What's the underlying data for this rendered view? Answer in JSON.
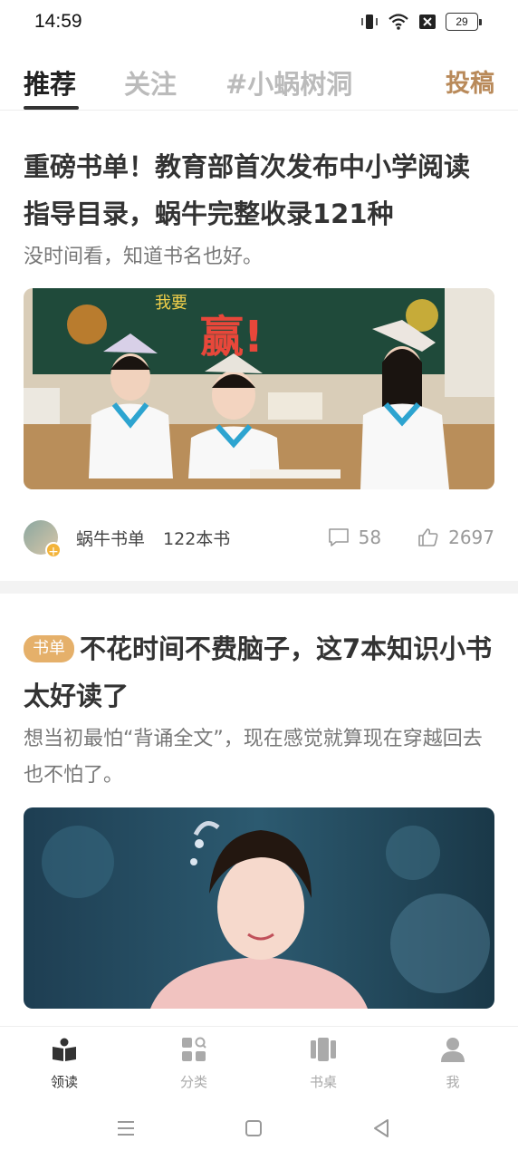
{
  "status_bar": {
    "time": "14:59",
    "battery": "29"
  },
  "tabs": [
    {
      "label": "推荐",
      "active": true
    },
    {
      "label": "关注",
      "active": false
    },
    {
      "label": "#小蜗树洞",
      "active": false
    }
  ],
  "contribute_label": "投稿",
  "articles": [
    {
      "title": "重磅书单！教育部首次发布中小学阅读指导目录，蜗牛完整收录121种",
      "description": "没时间看，知道书名也好。",
      "author": "蜗牛书单",
      "book_count": "122本书",
      "comments": "58",
      "likes": "2697"
    },
    {
      "tag": "书单",
      "title": "不花时间不费脑子，这7本知识小书太好读了",
      "description": "想当初最怕“背诵全文”，现在感觉就算现在穿越回去也不怕了。"
    }
  ],
  "bottom_nav": [
    {
      "label": "领读",
      "icon": "book-open-icon",
      "active": true
    },
    {
      "label": "分类",
      "icon": "category-search-icon",
      "active": false
    },
    {
      "label": "书桌",
      "icon": "bookshelf-icon",
      "active": false
    },
    {
      "label": "我",
      "icon": "user-icon",
      "active": false
    }
  ],
  "colors": {
    "accent": "#b98a5a",
    "tag_bg": "#e5b06a"
  }
}
